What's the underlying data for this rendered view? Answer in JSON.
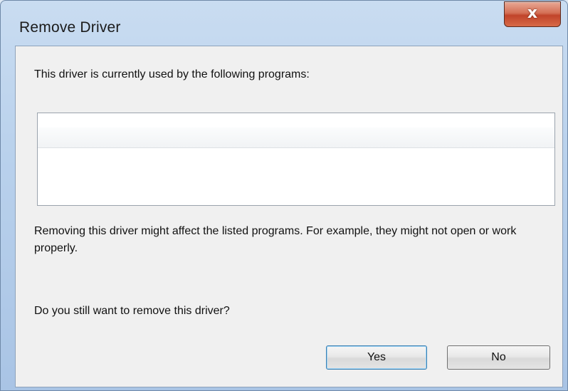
{
  "window": {
    "title": "Remove Driver",
    "close_glyph": "x",
    "close_icon": "close-icon"
  },
  "dialog": {
    "message_top": "This driver is currently used by the following programs:",
    "programs": [],
    "message_warning": "Removing this driver might affect the listed programs. For example, they might not open or work properly.",
    "question": "Do you still want to remove this driver?"
  },
  "buttons": {
    "yes_label": "Yes",
    "no_label": "No"
  },
  "colors": {
    "close_button": "#c1442a",
    "default_button_border": "#3c7fb1",
    "frame": "#b9d1ec"
  }
}
